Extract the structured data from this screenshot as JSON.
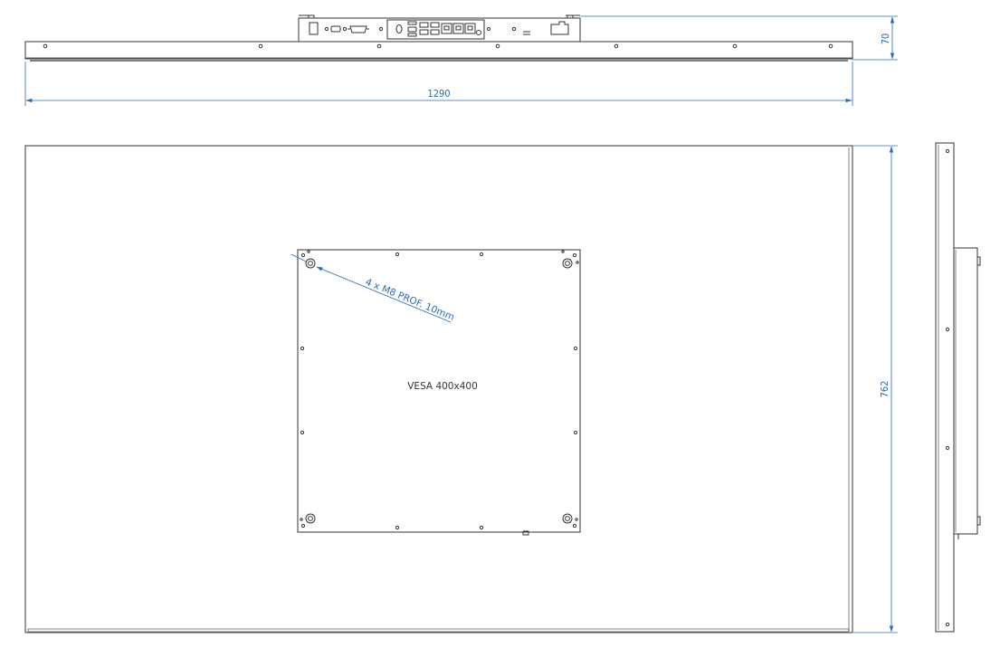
{
  "drawing": {
    "dimensions": {
      "overall_width": "1290",
      "depth": "70",
      "height": "762"
    },
    "labels": {
      "mount_holes": "4 x M8 PROF. 10mm",
      "vesa": "VESA 400x400"
    },
    "colors": {
      "outline": "#333333",
      "dimension": "#2b6cb0",
      "background": "#ffffff"
    }
  }
}
